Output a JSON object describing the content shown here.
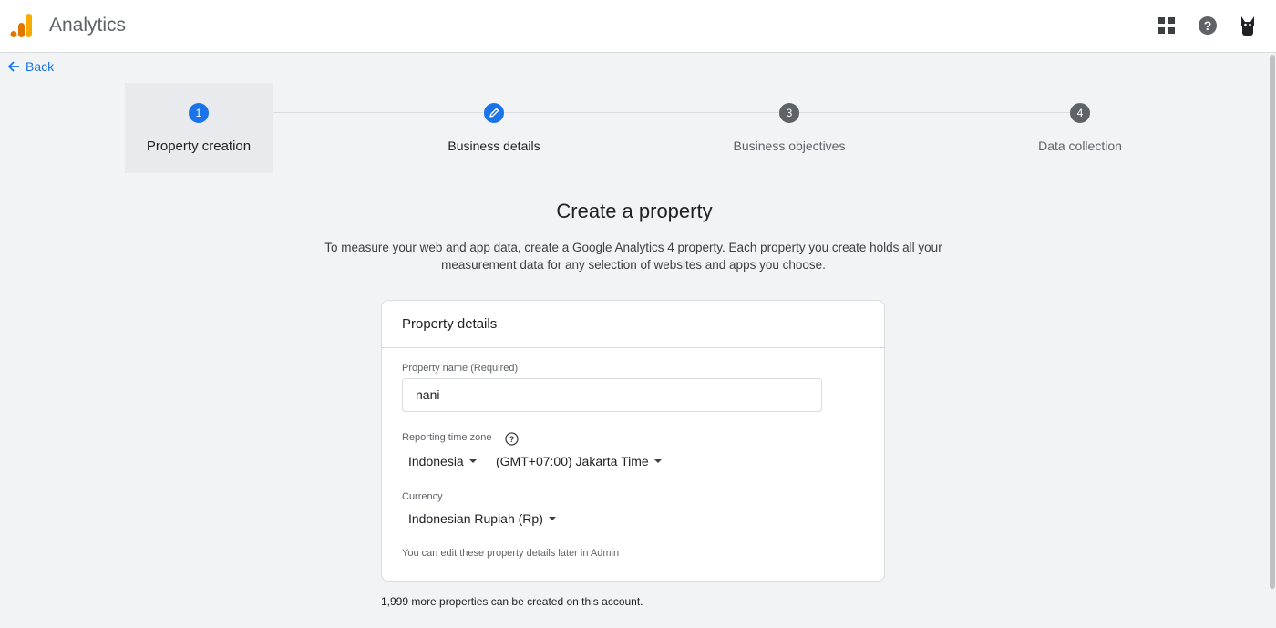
{
  "app": {
    "title": "Analytics"
  },
  "nav": {
    "back_label": "Back"
  },
  "steps": [
    {
      "number": "1",
      "label": "Property creation"
    },
    {
      "number": "",
      "label": "Business details"
    },
    {
      "number": "3",
      "label": "Business objectives"
    },
    {
      "number": "4",
      "label": "Data collection"
    }
  ],
  "page": {
    "title": "Create a property",
    "description": "To measure your web and app data, create a Google Analytics 4 property. Each property you create holds all your measurement data for any selection of websites and apps you choose."
  },
  "card": {
    "header": "Property details",
    "property_name_label": "Property name (Required)",
    "property_name_value": "nani",
    "timezone_label": "Reporting time zone",
    "country_value": "Indonesia",
    "timezone_value": "(GMT+07:00) Jakarta Time",
    "currency_label": "Currency",
    "currency_value": "Indonesian Rupiah (Rp)",
    "note": "You can edit these property details later in Admin"
  },
  "footer": {
    "quota_note": "1,999 more properties can be created on this account."
  },
  "colors": {
    "accent": "#1a73e8",
    "step_inactive": "#5f6368",
    "logo_orange": "#f9ab00",
    "logo_dark_orange": "#e37400"
  }
}
